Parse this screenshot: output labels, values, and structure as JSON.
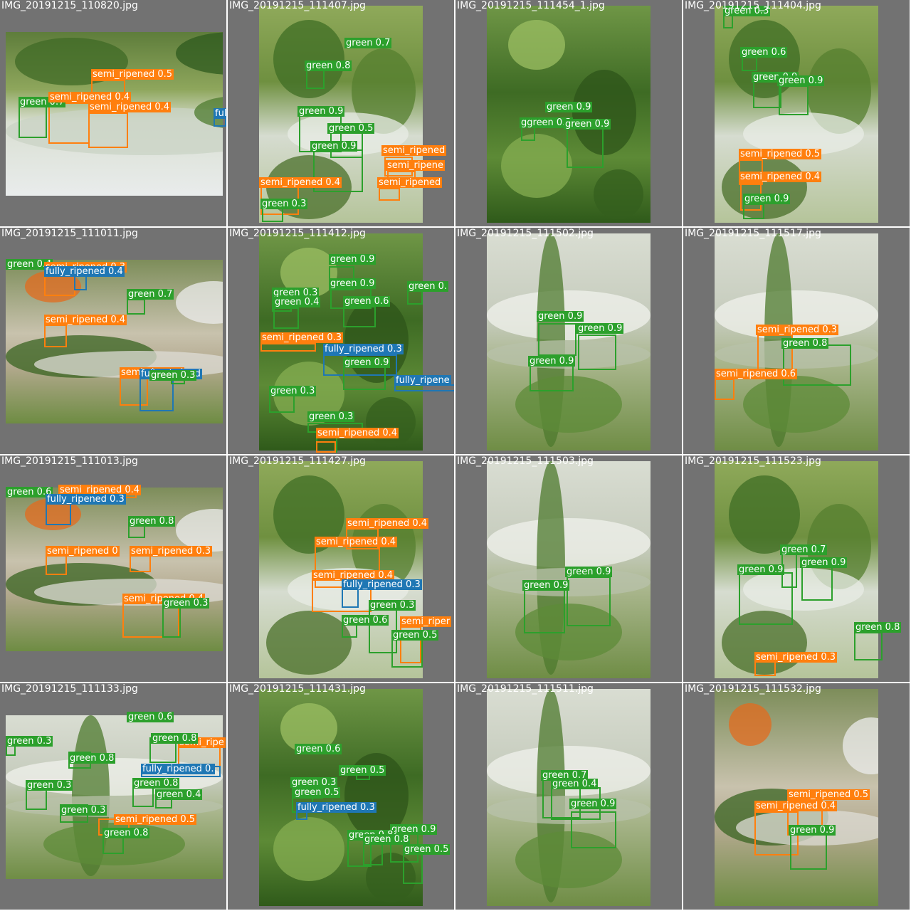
{
  "colors": {
    "green": "#2ca02c",
    "semi_ripened": "#ff7f0e",
    "fully_ripened": "#1f77b4",
    "cell_bg": "#727272",
    "separator": "#ffffff"
  },
  "images": [
    {
      "file": "IMG_20191215_110820.jpg",
      "scene": "greenhouse-foliage",
      "dets": [
        {
          "cls": "semi_ripened",
          "label": "semi_ripened 0.5"
        },
        {
          "cls": "green",
          "label": "green 0.7"
        },
        {
          "cls": "semi_ripened",
          "label": "semi_ripened 0.4"
        },
        {
          "cls": "semi_ripened",
          "label": "semi_ripened 0.4"
        },
        {
          "cls": "fully_ripened",
          "label": "fully_ripened"
        }
      ]
    },
    {
      "file": "IMG_20191215_111407.jpg",
      "scene": "greenhouse-plants",
      "dets": [
        {
          "cls": "green",
          "label": "green 0.7"
        },
        {
          "cls": "green",
          "label": "green 0.8"
        },
        {
          "cls": "green",
          "label": "green 0.9"
        },
        {
          "cls": "green",
          "label": "green 0.5"
        },
        {
          "cls": "green",
          "label": "green 0.9"
        },
        {
          "cls": "semi_ripened",
          "label": "semi_ripened"
        },
        {
          "cls": "semi_ripened",
          "label": "semi_ripene"
        },
        {
          "cls": "semi_ripened",
          "label": "semi_ripened 0.4"
        },
        {
          "cls": "semi_ripened",
          "label": "semi_ripened"
        },
        {
          "cls": "green",
          "label": "green 0.3"
        }
      ]
    },
    {
      "file": "IMG_20191215_111454_1.jpg",
      "scene": "dense-foliage",
      "dets": [
        {
          "cls": "green",
          "label": "green 0.9"
        },
        {
          "cls": "green",
          "label": "ggreen 0.3"
        },
        {
          "cls": "green",
          "label": "green 0.9"
        }
      ]
    },
    {
      "file": "IMG_20191215_111404.jpg",
      "scene": "greenhouse-plants",
      "dets": [
        {
          "cls": "green",
          "label": "green 0.3"
        },
        {
          "cls": "green",
          "label": "green 0.6"
        },
        {
          "cls": "green",
          "label": "green 0.9"
        },
        {
          "cls": "green",
          "label": "green 0.9"
        },
        {
          "cls": "semi_ripened",
          "label": "semi_ripened 0.5"
        },
        {
          "cls": "semi_ripened",
          "label": "semi_ripened 0.4"
        },
        {
          "cls": "green",
          "label": "green 0.9"
        }
      ]
    },
    {
      "file": "IMG_20191215_111011.jpg",
      "scene": "greenhouse-ground",
      "dets": [
        {
          "cls": "green",
          "label": "green 0.4"
        },
        {
          "cls": "semi_ripened",
          "label": "semi_ripened 0.3"
        },
        {
          "cls": "fully_ripened",
          "label": "fully_ripened 0.4"
        },
        {
          "cls": "green",
          "label": "green 0.7"
        },
        {
          "cls": "semi_ripened",
          "label": "semi_ripened 0.4"
        },
        {
          "cls": "semi_ripened",
          "label": "semi_ripened"
        },
        {
          "cls": "fully_ripened",
          "label": "fully_ripened"
        },
        {
          "cls": "green",
          "label": "green 0.3"
        }
      ]
    },
    {
      "file": "IMG_20191215_111412.jpg",
      "scene": "dense-foliage",
      "dets": [
        {
          "cls": "green",
          "label": "green 0.9"
        },
        {
          "cls": "green",
          "label": "green 0.9"
        },
        {
          "cls": "green",
          "label": "green 0.3"
        },
        {
          "cls": "green",
          "label": "green 0.4"
        },
        {
          "cls": "green",
          "label": "green 0.6"
        },
        {
          "cls": "green",
          "label": "green 0."
        },
        {
          "cls": "semi_ripened",
          "label": "semi_ripened 0.3"
        },
        {
          "cls": "fully_ripened",
          "label": "fully_ripened 0.3"
        },
        {
          "cls": "green",
          "label": "green 0.9"
        },
        {
          "cls": "green",
          "label": "green 0.3"
        },
        {
          "cls": "fully_ripened",
          "label": "fully_ripene"
        },
        {
          "cls": "green",
          "label": "green 0.3"
        },
        {
          "cls": "green",
          "label": "green 0.5"
        },
        {
          "cls": "semi_ripened",
          "label": "semi_ripened 0.4"
        }
      ]
    },
    {
      "file": "IMG_20191215_111502.jpg",
      "scene": "greenhouse-film",
      "dets": [
        {
          "cls": "green",
          "label": "green 0.9"
        },
        {
          "cls": "green",
          "label": "green 0.9"
        },
        {
          "cls": "green",
          "label": "green 0.9"
        }
      ]
    },
    {
      "file": "IMG_20191215_111517.jpg",
      "scene": "greenhouse-film",
      "dets": [
        {
          "cls": "semi_ripened",
          "label": "semi_ripened 0.3"
        },
        {
          "cls": "green",
          "label": "green 0.8"
        },
        {
          "cls": "semi_ripened",
          "label": "semi_ripened 0.6"
        }
      ]
    },
    {
      "file": "IMG_20191215_111013.jpg",
      "scene": "greenhouse-ground",
      "dets": [
        {
          "cls": "green",
          "label": "green 0.6"
        },
        {
          "cls": "semi_ripened",
          "label": "semi_ripened 0.4"
        },
        {
          "cls": "fully_ripened",
          "label": "fully_ripened 0.3"
        },
        {
          "cls": "green",
          "label": "green 0.8"
        },
        {
          "cls": "semi_ripened",
          "label": "semi_ripened 0"
        },
        {
          "cls": "semi_ripened",
          "label": "semi_ripened 0.3"
        },
        {
          "cls": "semi_ripened",
          "label": "semi_ripened 0.4"
        },
        {
          "cls": "green",
          "label": "green 0.3"
        }
      ]
    },
    {
      "file": "IMG_20191215_111427.jpg",
      "scene": "greenhouse-plants",
      "dets": [
        {
          "cls": "semi_ripened",
          "label": "semi_ripened 0.4"
        },
        {
          "cls": "semi_ripened",
          "label": "semi_ripened 0.4"
        },
        {
          "cls": "semi_ripened",
          "label": "semi_ripened 0.4"
        },
        {
          "cls": "fully_ripened",
          "label": "fully_ripened 0.3"
        },
        {
          "cls": "green",
          "label": "green 0.3"
        },
        {
          "cls": "green",
          "label": "green 0.6"
        },
        {
          "cls": "semi_ripened",
          "label": "semi_riper"
        },
        {
          "cls": "green",
          "label": "green 0.5"
        }
      ]
    },
    {
      "file": "IMG_20191215_111503.jpg",
      "scene": "greenhouse-film",
      "dets": [
        {
          "cls": "green",
          "label": "green 0.9"
        },
        {
          "cls": "green",
          "label": "green 0.9"
        }
      ]
    },
    {
      "file": "IMG_20191215_111523.jpg",
      "scene": "greenhouse-plants",
      "dets": [
        {
          "cls": "green",
          "label": "green 0.7"
        },
        {
          "cls": "green",
          "label": "green 0.9"
        },
        {
          "cls": "green",
          "label": "green 0.9"
        },
        {
          "cls": "green",
          "label": "green 0.8"
        },
        {
          "cls": "semi_ripened",
          "label": "semi_ripened 0.3"
        }
      ]
    },
    {
      "file": "IMG_20191215_111133.jpg",
      "scene": "greenhouse-film",
      "dets": [
        {
          "cls": "green",
          "label": "green 0.6"
        },
        {
          "cls": "green",
          "label": "green 0.3"
        },
        {
          "cls": "green",
          "label": "green 0.8"
        },
        {
          "cls": "semi_ripened",
          "label": "semi_ripe"
        },
        {
          "cls": "green",
          "label": "green 0.8"
        },
        {
          "cls": "fully_ripened",
          "label": "fully_ripened 0."
        },
        {
          "cls": "green",
          "label": "green 0.3"
        },
        {
          "cls": "green",
          "label": "green 0.8"
        },
        {
          "cls": "green",
          "label": "green 0.4"
        },
        {
          "cls": "green",
          "label": "green 0.3"
        },
        {
          "cls": "semi_ripened",
          "label": "semi_ripened 0.5"
        },
        {
          "cls": "green",
          "label": "green 0.8"
        }
      ]
    },
    {
      "file": "IMG_20191215_111431.jpg",
      "scene": "dense-foliage",
      "dets": [
        {
          "cls": "green",
          "label": "green 0.6"
        },
        {
          "cls": "green",
          "label": "green 0.5"
        },
        {
          "cls": "green",
          "label": "green 0.3"
        },
        {
          "cls": "green",
          "label": "green 0.5"
        },
        {
          "cls": "fully_ripened",
          "label": "fully_ripened 0.3"
        },
        {
          "cls": "green",
          "label": "green 0.9"
        },
        {
          "cls": "green",
          "label": "green 0.8"
        },
        {
          "cls": "green",
          "label": "green 0.8"
        },
        {
          "cls": "green",
          "label": "green 0.5"
        }
      ]
    },
    {
      "file": "IMG_20191215_111511.jpg",
      "scene": "greenhouse-film",
      "dets": [
        {
          "cls": "green",
          "label": "green 0.7"
        },
        {
          "cls": "green",
          "label": "green 0.4"
        },
        {
          "cls": "green",
          "label": "green 0.9"
        }
      ]
    },
    {
      "file": "IMG_20191215_111532.jpg",
      "scene": "greenhouse-ground",
      "dets": [
        {
          "cls": "semi_ripened",
          "label": "semi_ripened 0.5"
        },
        {
          "cls": "semi_ripened",
          "label": "semi_ripened 0.4"
        },
        {
          "cls": "green",
          "label": "green 0.9"
        }
      ]
    }
  ]
}
